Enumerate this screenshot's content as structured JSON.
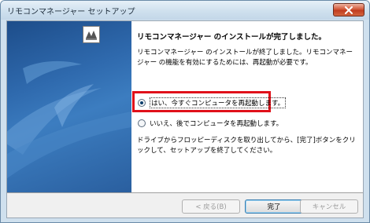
{
  "window": {
    "title": "リモコンマネージャー セットアップ"
  },
  "content": {
    "heading": "リモコンマネージャー のインストールが完了しました。",
    "description": "リモコンマネージャー のインストールが終了しました。リモコンマネージャー の機能を有効にするためには、再起動が必要です。",
    "options": [
      {
        "label": "はい、今すぐコンピュータを再起動します。",
        "selected": true
      },
      {
        "label": "いいえ、後でコンピュータを再起動します。",
        "selected": false
      }
    ],
    "note": "ドライブからフロッピーディスクを取り出してから、[完了]ボタンをクリックして、セットアップを終了してください。"
  },
  "buttons": {
    "back": "< 戻る(B)",
    "finish": "完了",
    "cancel": "キャンセル"
  },
  "colors": {
    "highlight": "#e0101a",
    "side_panel": "#2f6aae"
  },
  "icons": [
    "close-icon",
    "setup-logo-icon"
  ]
}
